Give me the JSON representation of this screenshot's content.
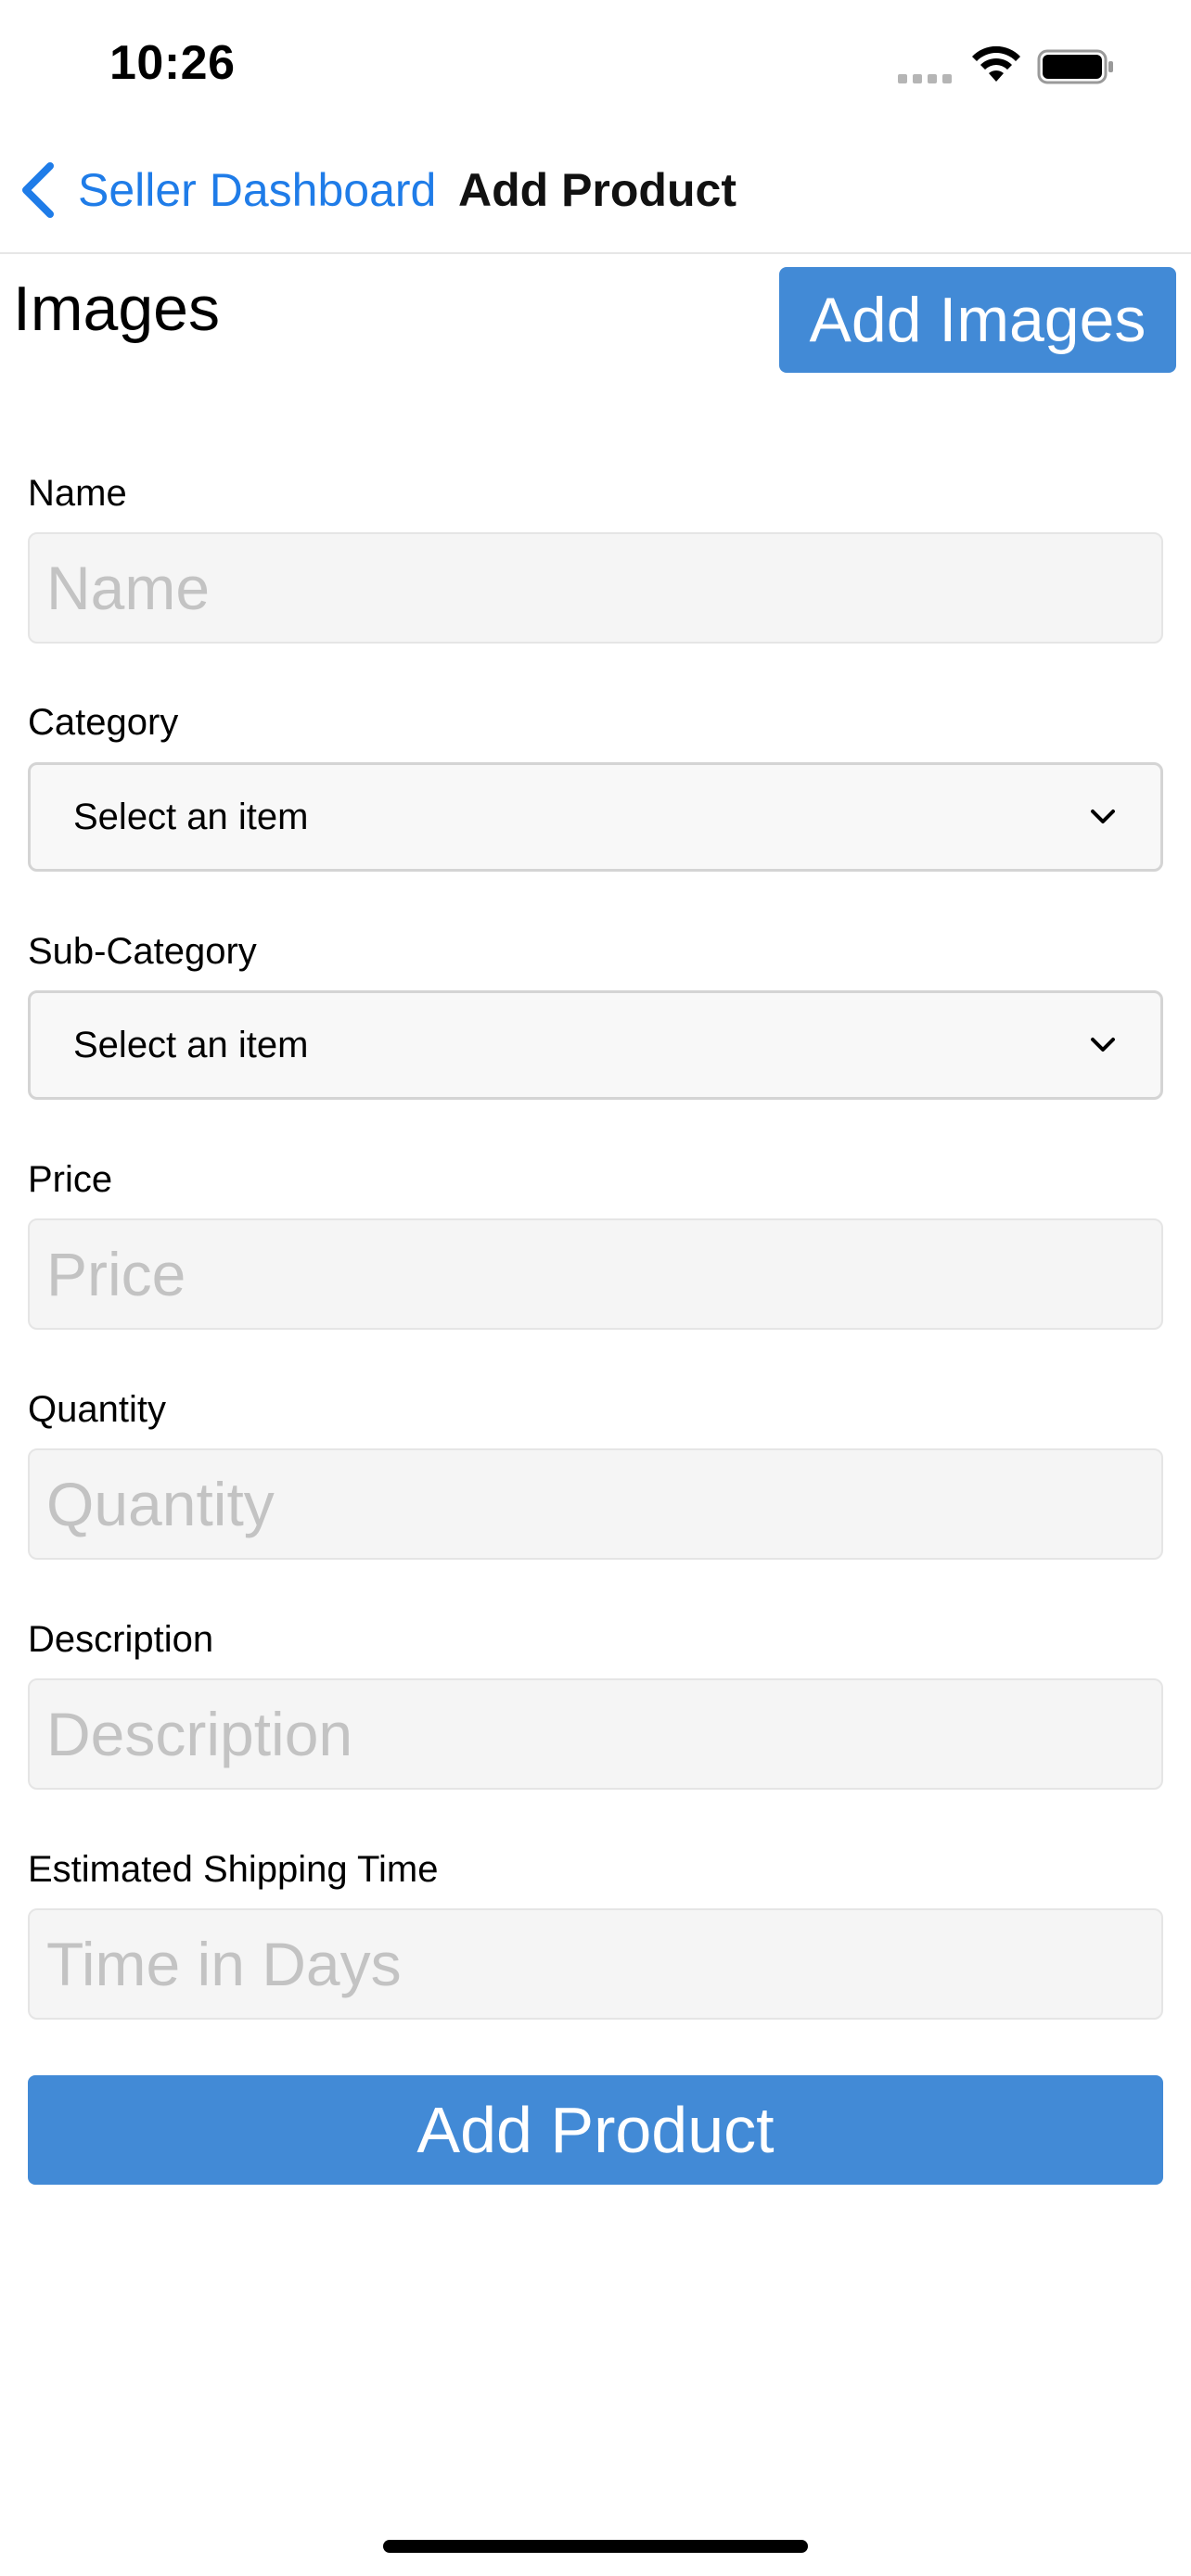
{
  "status_bar": {
    "time": "10:26"
  },
  "nav": {
    "back_label": "Seller Dashboard",
    "title": "Add Product"
  },
  "images": {
    "heading": "Images",
    "add_button_label": "Add Images"
  },
  "form": {
    "name": {
      "label": "Name",
      "value": "",
      "placeholder": "Name"
    },
    "category": {
      "label": "Category",
      "selected": "Select an item"
    },
    "sub_category": {
      "label": "Sub-Category",
      "selected": "Select an item"
    },
    "price": {
      "label": "Price",
      "value": "",
      "placeholder": "Price"
    },
    "quantity": {
      "label": "Quantity",
      "value": "",
      "placeholder": "Quantity"
    },
    "description": {
      "label": "Description",
      "value": "",
      "placeholder": "Description"
    },
    "shipping_time": {
      "label": "Estimated Shipping Time",
      "value": "",
      "placeholder": "Time in Days"
    },
    "submit_label": "Add Product"
  },
  "colors": {
    "accent": "#428ad6",
    "link": "#1f7ce8",
    "placeholder": "#c3c3c3",
    "input_bg": "#f5f5f5"
  },
  "icons": {
    "back": "chevron-left-icon",
    "dropdown": "chevron-down-icon",
    "wifi": "wifi-icon",
    "battery": "battery-icon",
    "signal": "cellular-signal-icon"
  }
}
